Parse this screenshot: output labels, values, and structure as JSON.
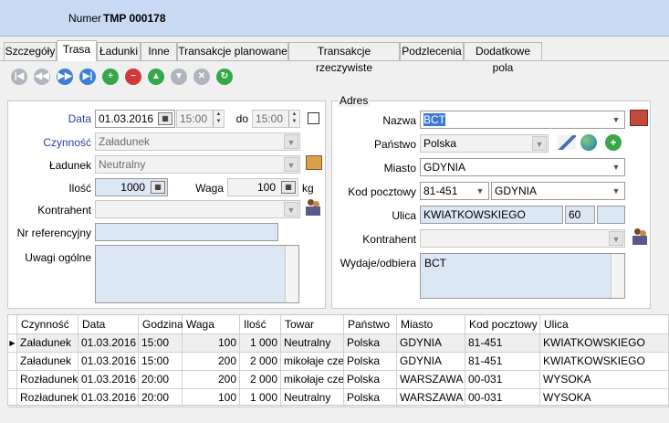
{
  "header": {
    "number_label": "Numer",
    "number_value": "TMP 000178"
  },
  "tabs": [
    "Szczegóły",
    "Trasa",
    "Ładunki",
    "Inne",
    "Transakcje planowane",
    "Transakcje rzeczywiste",
    "Podzlecenia",
    "Dodatkowe pola"
  ],
  "nav_icons": [
    "first-icon",
    "prev-icon",
    "next-icon",
    "last-icon",
    "add-icon",
    "delete-icon",
    "move-up-icon",
    "move-down-icon",
    "cancel-icon",
    "refresh-icon"
  ],
  "left": {
    "data_label": "Data",
    "data_value": "01.03.2016",
    "time_from": "15:00",
    "do_label": "do",
    "time_to": "15:00",
    "czynnosc_label": "Czynność",
    "czynnosc_value": "Załadunek",
    "ladunek_label": "Ładunek",
    "ladunek_value": "Neutralny",
    "ilosc_label": "Ilość",
    "ilosc_value": "1000",
    "waga_label": "Waga",
    "waga_value": "100",
    "waga_unit": "kg",
    "kontrahent_label": "Kontrahent",
    "kontrahent_value": "",
    "nr_label": "Nr referencyjny",
    "nr_value": "",
    "uwagi_label": "Uwagi ogólne",
    "uwagi_value": ""
  },
  "address": {
    "title": "Adres",
    "nazwa_label": "Nazwa",
    "nazwa_value": "BCT",
    "panstwo_label": "Państwo",
    "panstwo_value": "Polska",
    "miasto_label": "Miasto",
    "miasto_value": "GDYNIA",
    "kod_label": "Kod pocztowy",
    "kod_value": "81-451",
    "kod_city": "GDYNIA",
    "ulica_label": "Ulica",
    "ulica_value": "KWIATKOWSKIEGO",
    "ulica_nr": "60",
    "ulica_nr2": "",
    "kontrahent_label": "Kontrahent",
    "kontrahent_value": "",
    "wydaje_label": "Wydaje/odbiera",
    "wydaje_value": "BCT"
  },
  "grid": {
    "columns": [
      "Czynność",
      "Data",
      "Godzina",
      "Waga",
      "Ilość",
      "Towar",
      "Państwo",
      "Miasto",
      "Kod pocztowy",
      "Ulica"
    ],
    "rows": [
      [
        "Załadunek",
        "01.03.2016",
        "15:00",
        "100",
        "1 000",
        "Neutralny",
        "Polska",
        "GDYNIA",
        "81-451",
        "KWIATKOWSKIEGO"
      ],
      [
        "Załadunek",
        "01.03.2016",
        "15:00",
        "200",
        "2 000",
        "mikołaje czekolad",
        "Polska",
        "GDYNIA",
        "81-451",
        "KWIATKOWSKIEGO"
      ],
      [
        "Rozładunek",
        "01.03.2016",
        "20:00",
        "200",
        "2 000",
        "mikołaje czekolad",
        "Polska",
        "WARSZAWA",
        "00-031",
        "WYSOKA"
      ],
      [
        "Rozładunek",
        "01.03.2016",
        "20:00",
        "100",
        "1 000",
        "Neutralny",
        "Polska",
        "WARSZAWA",
        "00-031",
        "WYSOKA"
      ]
    ],
    "selected_row": 0
  }
}
